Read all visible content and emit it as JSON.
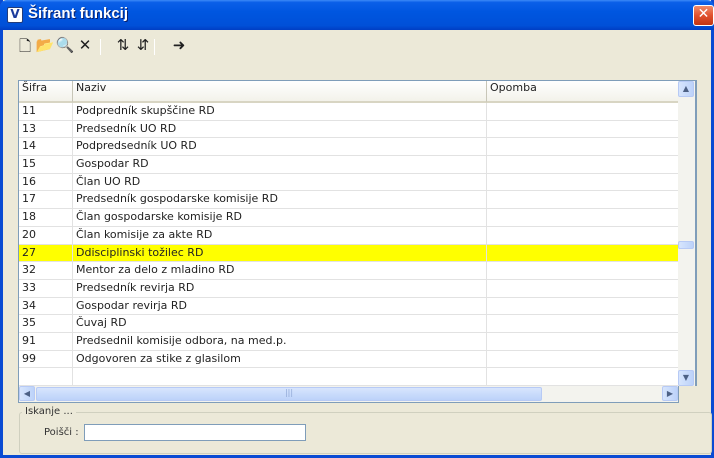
{
  "window": {
    "title": "Šifrant funkcij",
    "icon_glyph": "V",
    "close_glyph": "✕"
  },
  "toolbar": [
    {
      "name": "new-icon",
      "glyph": "🗋"
    },
    {
      "name": "open-folder-icon",
      "glyph": "📂"
    },
    {
      "name": "find-icon",
      "glyph": "🔍"
    },
    {
      "name": "delete-icon",
      "glyph": "✕"
    },
    {
      "name": "sort-ascending-icon",
      "glyph": "⇅"
    },
    {
      "name": "sort-descending-icon",
      "glyph": "⇵"
    },
    {
      "name": "exit-icon",
      "glyph": "➜"
    }
  ],
  "table": {
    "columns": [
      "Šifra",
      "Naziv",
      "Opomba"
    ],
    "rows": [
      [
        "11",
        "Podpredník skupščine RD",
        ""
      ],
      [
        "13",
        "Predsedník UO RD",
        ""
      ],
      [
        "14",
        "Podpredsedník UO RD",
        ""
      ],
      [
        "15",
        "Gospodar RD",
        ""
      ],
      [
        "16",
        "Član UO RD",
        ""
      ],
      [
        "17",
        "Predsedník gospodarske komisije RD",
        ""
      ],
      [
        "18",
        "Član gospodarske komisije RD",
        ""
      ],
      [
        "20",
        "Član komisije za akte RD",
        ""
      ],
      [
        "27",
        "Ddisciplinski tožilec RD",
        ""
      ],
      [
        "32",
        "Mentor za delo z mladino RD",
        ""
      ],
      [
        "33",
        "Predsedník revirja RD",
        ""
      ],
      [
        "34",
        "Gospodar revirja RD",
        ""
      ],
      [
        "35",
        "Čuvaj RD",
        ""
      ],
      [
        "91",
        "Predsednil komisije odbora, na med.p.",
        ""
      ],
      [
        "99",
        "Odgovoren za stike z glasilom",
        ""
      ],
      [
        "",
        "",
        ""
      ]
    ],
    "selected_index": 8
  },
  "scroll": {
    "up": "▲",
    "down": "▼",
    "left": "◀",
    "right": "▶",
    "grip": "|||"
  },
  "search": {
    "group_title": "Iskanje ...",
    "label": "Poišči :",
    "value": ""
  }
}
